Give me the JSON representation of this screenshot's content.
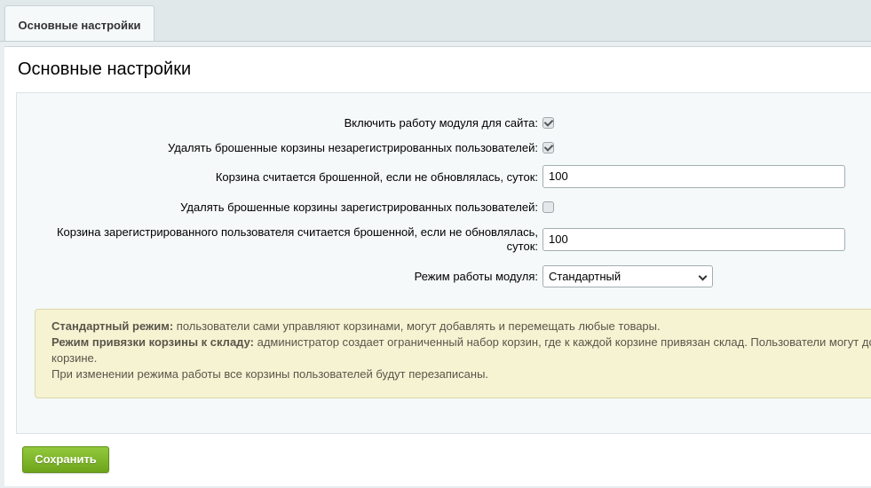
{
  "tabs": [
    {
      "label": "Основные настройки"
    }
  ],
  "panel": {
    "title": "Основные настройки"
  },
  "form": {
    "enable_module": {
      "label": "Включить работу модуля для сайта:",
      "checked": true
    },
    "delete_unregistered": {
      "label": "Удалять брошенные корзины незарегистрированных пользователей:",
      "checked": true
    },
    "abandoned_days": {
      "label": "Корзина считается брошенной, если не обновлялась, суток:",
      "value": "100"
    },
    "delete_registered": {
      "label": "Удалять брошенные корзины зарегистрированных пользователей:",
      "checked": false
    },
    "registered_days": {
      "label_line1": "Корзина зарегистрированного пользователя считается брошенной, если не обновлялась,",
      "label_line2": "суток:",
      "value": "100"
    },
    "mode": {
      "label": "Режим работы модуля:",
      "selected": "Стандартный"
    }
  },
  "note": {
    "line1_bold": "Стандартный режим:",
    "line1_text": " пользователи сами управляют корзинами, могут добавлять и перемещать любые товары.",
    "line2_bold": "Режим привязки корзины к складу:",
    "line2_text": " администратор создает ограниченный набор корзин, где к каждой корзине привязан склад. Пользователи могут до",
    "line3_text": "корзине.",
    "line4_text": "При изменении режима работы все корзины пользователей будут перезаписаны."
  },
  "actions": {
    "save_label": "Сохранить"
  },
  "colors": {
    "save_button": "#7fb52a",
    "note_background": "#f6f3d3",
    "form_background": "#f5f9f9"
  }
}
